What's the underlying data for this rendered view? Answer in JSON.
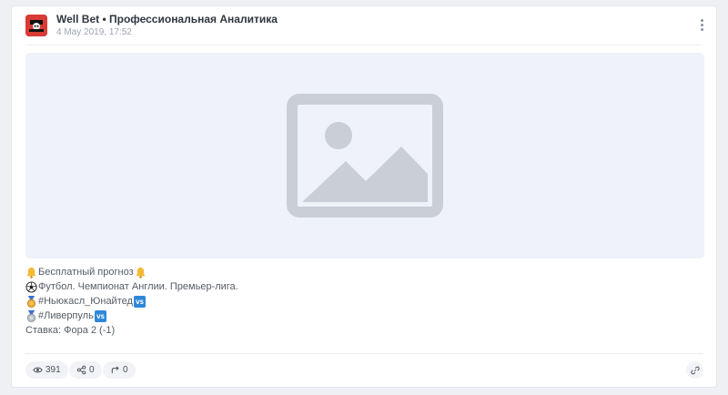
{
  "post": {
    "channel_name": "Well Bet • Профессиональная Аналитика",
    "date": "4 May 2019, 17:52",
    "menu_icon": "more-vertical-icon",
    "image_placeholder_icon": "image-placeholder-icon",
    "lines": [
      {
        "icon": "bell-icon",
        "text": "Бесплатный прогноз",
        "icon_after": "bell-icon"
      },
      {
        "icon": "soccer-ball-icon",
        "text": " Футбол. Чемпионат Англии. Премьер-лига."
      },
      {
        "icon": "medal-icon",
        "text": "#Ньюкасл_Юнайтед ",
        "icon_after": "vs-icon"
      },
      {
        "icon": "medal-icon",
        "text": "#Ливерпуль",
        "icon_after": "vs-icon"
      },
      {
        "text": "Ставка: Фора 2 (-1)"
      }
    ]
  },
  "footer": {
    "views": "391",
    "shares": "0",
    "reposts": "0",
    "views_icon": "eye-icon",
    "shares_icon": "share-icon",
    "reposts_icon": "repost-icon",
    "link_icon": "link-icon"
  },
  "colors": {
    "avatar_bg": "#d83a35",
    "placeholder_bg": "#eff2f9",
    "placeholder_fg": "#c9ced7",
    "bell": "#f5b935"
  }
}
